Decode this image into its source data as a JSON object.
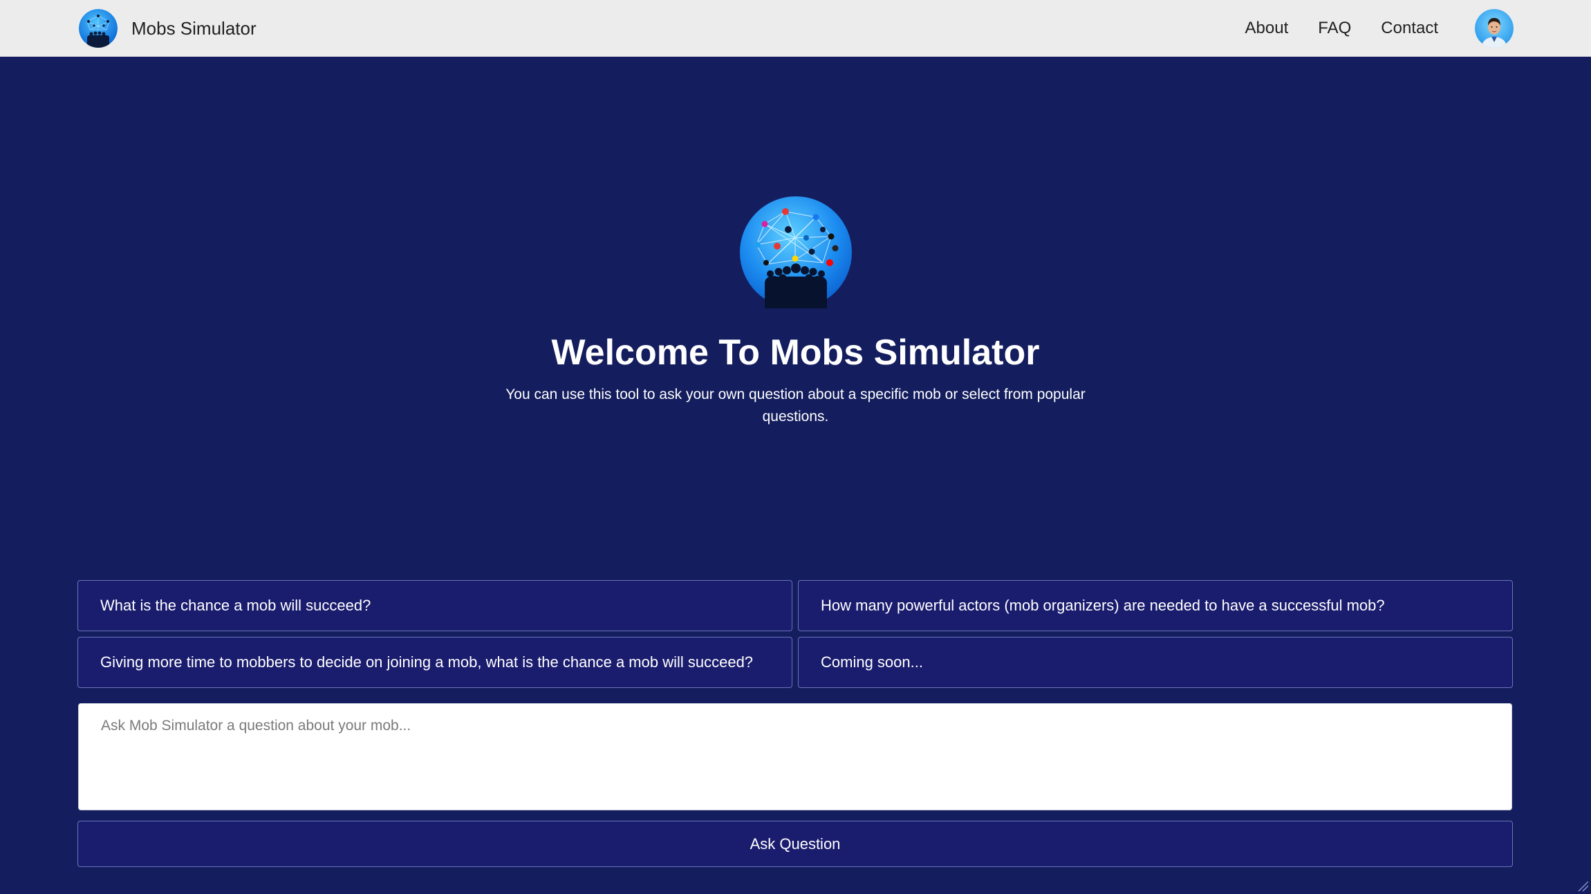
{
  "navbar": {
    "brand_name": "Mobs Simulator",
    "links": [
      "About",
      "FAQ",
      "Contact"
    ]
  },
  "hero": {
    "title": "Welcome To Mobs Simulator",
    "subtitle": "You can use this tool to ask your own question about a specific mob or select from popular questions."
  },
  "questions": [
    "What is the chance a mob will succeed?",
    "How many powerful actors (mob organizers) are needed to have a successful mob?",
    "Giving more time to mobbers to decide on joining a mob, what is the chance a mob will succeed?",
    "Coming soon..."
  ],
  "ask": {
    "placeholder": "Ask Mob Simulator a question about your mob...",
    "button_label": "Ask Question"
  },
  "colors": {
    "page_bg": "#141e5e",
    "navbar_bg": "#ececec",
    "button_bg": "#1a1c6e",
    "button_border": "#6a74b8",
    "logo_blue": "#1e90ff"
  },
  "icons": {
    "brand": "mobs-logo-icon",
    "avatar": "user-avatar-icon",
    "hero": "mobs-network-crowd-icon"
  }
}
